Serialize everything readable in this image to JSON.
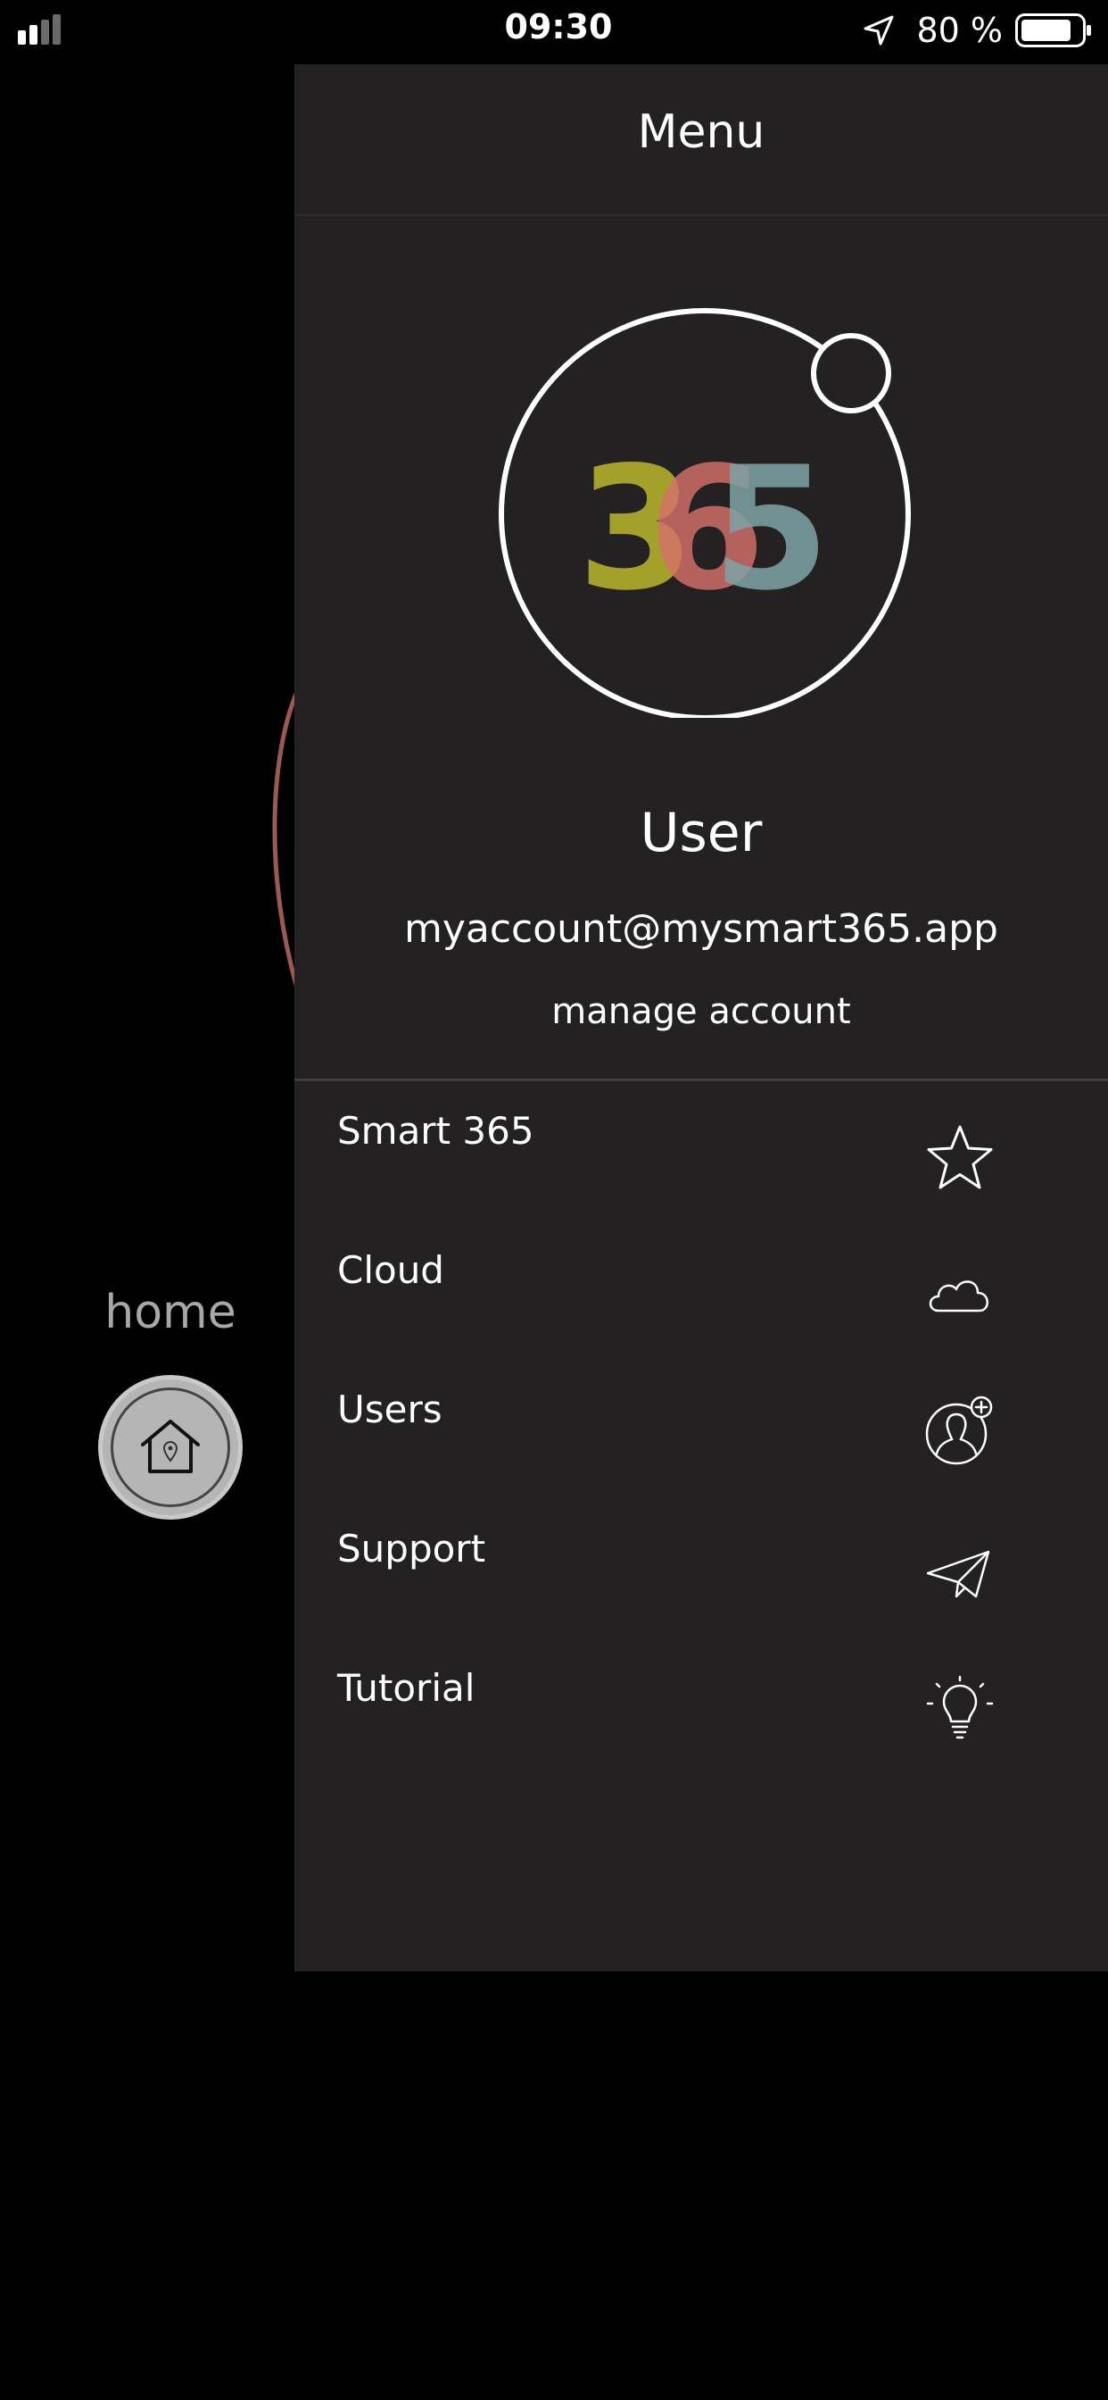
{
  "status_bar": {
    "time": "09:30",
    "battery": "80 %",
    "signal_icon": "signal-bars-icon",
    "location_icon": "location-arrow-icon",
    "battery_icon": "battery-icon"
  },
  "background": {
    "home_label": "home",
    "home_icon": "house-pin-icon"
  },
  "drawer": {
    "title": "Menu",
    "logo_text": "365",
    "user_name": "User",
    "email": "myaccount@mysmart365.app",
    "manage_label": "manage account",
    "items": [
      {
        "label": "Smart 365",
        "icon": "star-icon"
      },
      {
        "label": "Cloud",
        "icon": "cloud-icon"
      },
      {
        "label": "Users",
        "icon": "user-add-icon"
      },
      {
        "label": "Support",
        "icon": "paper-plane-icon"
      },
      {
        "label": "Tutorial",
        "icon": "lightbulb-icon"
      }
    ]
  },
  "colors": {
    "background": "#000000",
    "drawer": "#232122",
    "logo_3": "#a3a129",
    "logo_6": "#d5706a",
    "logo_5": "#7ea3a5",
    "accent_arc": "#9a5a52"
  }
}
